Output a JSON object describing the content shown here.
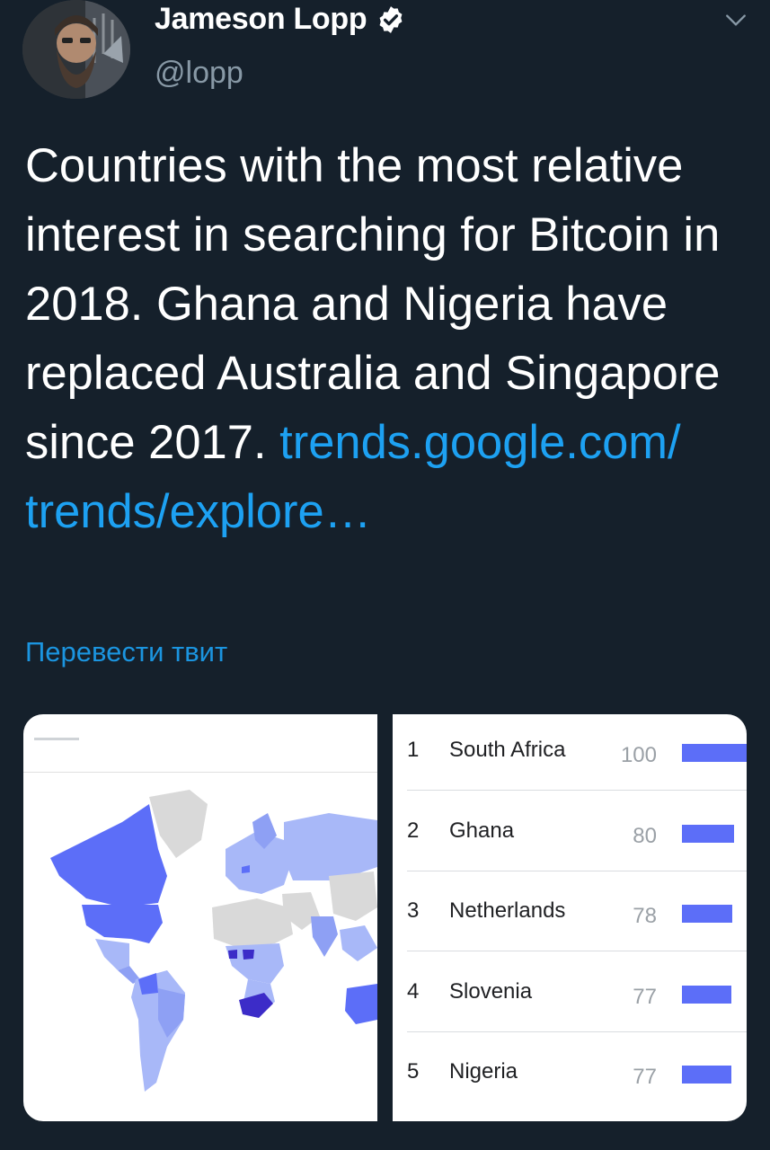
{
  "tweet": {
    "author_name": "Jameson Lopp",
    "handle": "@lopp",
    "text_main": "Countries with the most relative interest in searching for Bitcoin in 2018. Ghana and Nigeria have replaced Australia and Singapore since 2017.",
    "link_text": "trends.google.com/ trends/explore…",
    "translate_label": "Перевести твит"
  },
  "icons": {
    "verified": "verified-badge-icon",
    "chevron": "chevron-down-icon"
  },
  "colors": {
    "background": "#15202b",
    "link": "#1da1f2",
    "bar": "#5c6ef8",
    "map_high": "#3c2cc8",
    "map_mid": "#5c6ef8",
    "map_low": "#a8b8f8",
    "map_none": "#d9d9d9"
  },
  "ranking": [
    {
      "rank": "1",
      "country": "South Africa",
      "value": 100
    },
    {
      "rank": "2",
      "country": "Ghana",
      "value": 80
    },
    {
      "rank": "3",
      "country": "Netherlands",
      "value": 78
    },
    {
      "rank": "4",
      "country": "Slovenia",
      "value": 77
    },
    {
      "rank": "5",
      "country": "Nigeria",
      "value": 77
    }
  ]
}
